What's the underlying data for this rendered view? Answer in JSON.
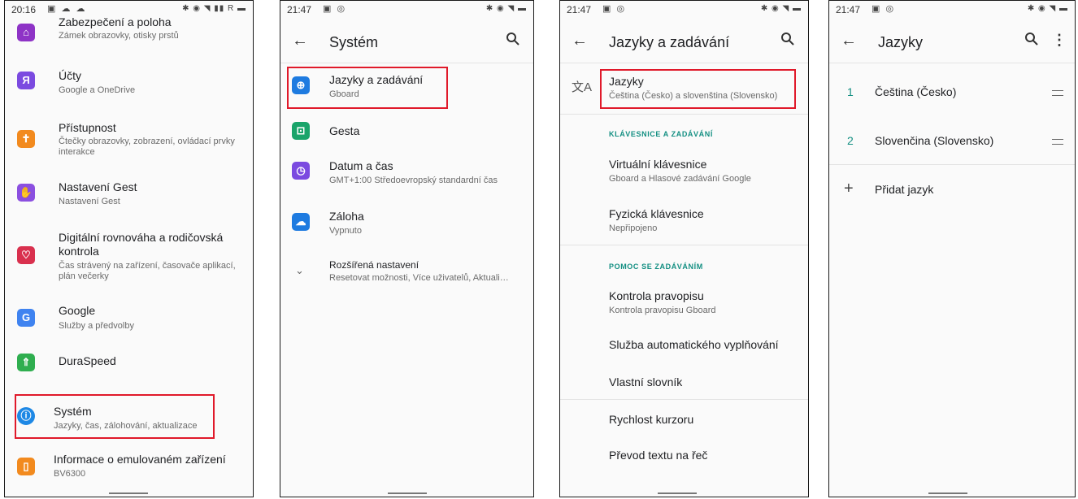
{
  "panel1": {
    "time": "20:16",
    "items": [
      {
        "title": "Zabezpečení a poloha",
        "subtitle": "Zámek obrazovky, otisky prstů"
      },
      {
        "title": "Účty",
        "subtitle": "Google a OneDrive"
      },
      {
        "title": "Přístupnost",
        "subtitle": "Čtečky obrazovky, zobrazení, ovládací prvky",
        "subtitle2": "interakce"
      },
      {
        "title": "Nastavení Gest",
        "subtitle": "Nastavení Gest"
      },
      {
        "title": "Digitální rovnováha a rodičovská",
        "title2": "kontrola",
        "subtitle": "Čas strávený na zařízení, časovače aplikací,",
        "subtitle2": "plán večerky"
      },
      {
        "title": "Google",
        "subtitle": "Služby a předvolby"
      },
      {
        "title": "DuraSpeed"
      },
      {
        "title": "Systém",
        "subtitle": "Jazyky, čas, zálohování, aktualizace"
      },
      {
        "title": "Informace o emulovaném zařízení",
        "subtitle": "BV6300"
      }
    ]
  },
  "panel2": {
    "time": "21:47",
    "title": "Systém",
    "items": [
      {
        "title": "Jazyky a zadávání",
        "subtitle": "Gboard"
      },
      {
        "title": "Gesta"
      },
      {
        "title": "Datum a čas",
        "subtitle": "GMT+1:00 Středoevropský standardní čas"
      },
      {
        "title": "Záloha",
        "subtitle": "Vypnuto"
      },
      {
        "title": "Rozšířená nastavení",
        "subtitle": "Resetovat možnosti, Více uživatelů, Aktuali…"
      }
    ]
  },
  "panel3": {
    "time": "21:47",
    "title": "Jazyky a zadávání",
    "languages": {
      "title": "Jazyky",
      "subtitle": "Čeština (Česko) a slovenština (Slovensko)"
    },
    "section1": "KLÁVESNICE A ZADÁVÁNÍ",
    "keyboards": [
      {
        "title": "Virtuální klávesnice",
        "subtitle": "Gboard a Hlasové zadávání Google"
      },
      {
        "title": "Fyzická klávesnice",
        "subtitle": "Nepřipojeno"
      }
    ],
    "section2": "POMOC SE ZADÁVÁNÍM",
    "assist": [
      {
        "title": "Kontrola pravopisu",
        "subtitle": "Kontrola pravopisu Gboard"
      },
      {
        "title": "Služba automatického vyplňování"
      },
      {
        "title": "Vlastní slovník"
      }
    ],
    "more": [
      {
        "title": "Rychlost kurzoru"
      },
      {
        "title": "Převod textu na řeč"
      }
    ]
  },
  "panel4": {
    "time": "21:47",
    "title": "Jazyky",
    "languages": [
      {
        "num": "1",
        "name": "Čeština (Česko)"
      },
      {
        "num": "2",
        "name": "Slovenčina (Slovensko)"
      }
    ],
    "add": "Přidat jazyk"
  },
  "colors": {
    "highlight": "#e0192a",
    "accent": "#138f82"
  }
}
